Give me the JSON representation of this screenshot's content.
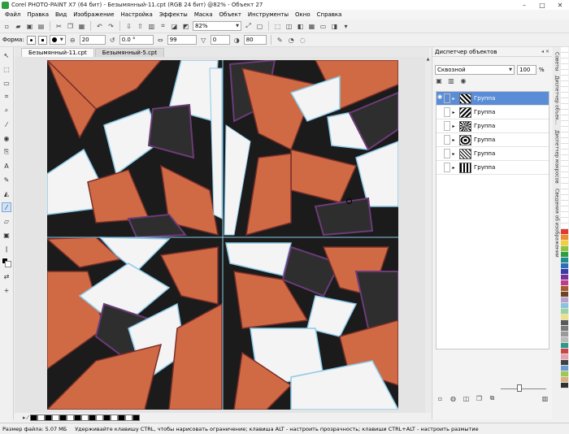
{
  "window": {
    "title": "Corel PHOTO-PAINT X7 (64 бит) - Безымянный-11.cpt (RGB 24 бит) @82% - Объект 27",
    "minimize": "–",
    "maximize": "□",
    "close": "✕"
  },
  "menu": [
    "Файл",
    "Правка",
    "Вид",
    "Изображение",
    "Настройка",
    "Эффекты",
    "Маска",
    "Объект",
    "Инструменты",
    "Окно",
    "Справка"
  ],
  "toolbar": {
    "zoom": "82%"
  },
  "property_bar": {
    "shape_label": "Форма:",
    "size": "20",
    "rotation": "0.0 °",
    "nib_value": "99",
    "transparency": "0",
    "soft_edge": "80"
  },
  "tabs": [
    {
      "label": "Безымянный-11.cpt",
      "active": true
    },
    {
      "label": "Безымянный-5.cpt",
      "active": false
    }
  ],
  "docker": {
    "title": "Диспетчер объектов",
    "merge_mode": "Сквозной",
    "opacity": "100",
    "opacity_unit": "%",
    "layers": [
      {
        "name": "Группа",
        "selected": true
      },
      {
        "name": "Группа",
        "selected": false
      },
      {
        "name": "Группа",
        "selected": false
      },
      {
        "name": "Группа",
        "selected": false
      },
      {
        "name": "Группа",
        "selected": false
      },
      {
        "name": "Группа",
        "selected": false
      }
    ]
  },
  "side_tabs": [
    "Советы",
    "Диспетчер объек...",
    "Диспетчер макросов",
    "Сведения об изображении"
  ],
  "status": {
    "file_size": "Размер файла: 5.07 МБ",
    "hint": "Удерживайте клавишу CTRL, чтобы нарисовать ограничение; клавиша ALT - настроить прозрачность; клавиши CTRL+ALT - настроить размытие"
  },
  "colors": {
    "accent": "#5b8dd6",
    "orange": "#d06a45",
    "black": "#1b1b1b",
    "white": "#f4f4f4"
  }
}
